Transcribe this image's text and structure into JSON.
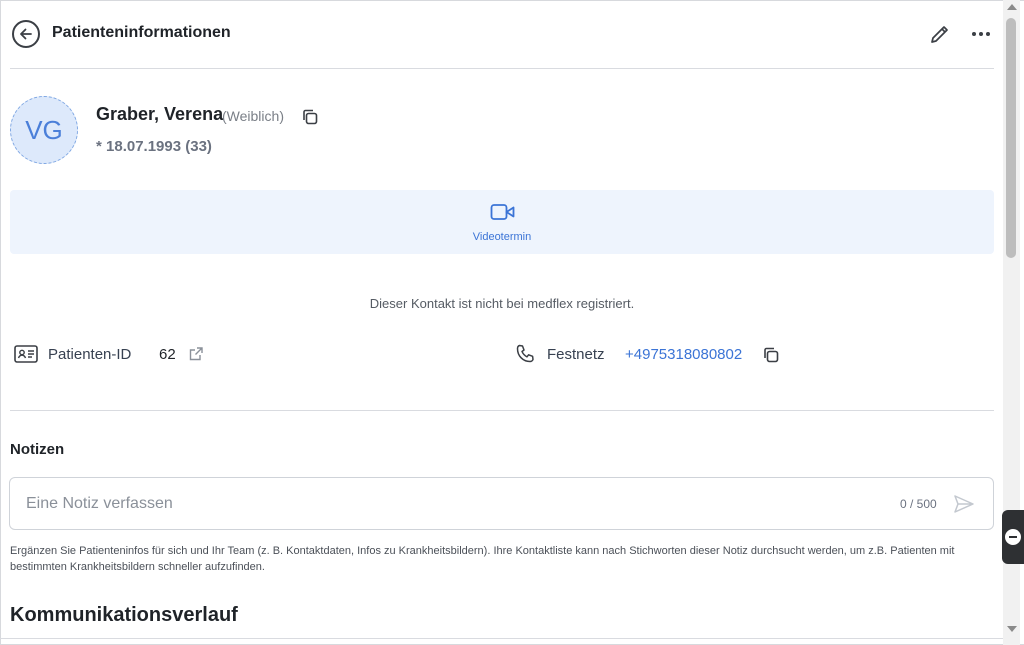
{
  "header": {
    "title": "Patienteninformationen",
    "back_icon": "arrow-left-circle-icon",
    "edit_icon": "pencil-icon",
    "more_icon": "ellipsis-icon"
  },
  "patient": {
    "initials": "VG",
    "name": "Graber, Verena",
    "gender": "(Weiblich)",
    "dob": "* 18.07.1993 (33)"
  },
  "video": {
    "label": "Videotermin",
    "icon": "video-camera-icon"
  },
  "status": {
    "not_registered": "Dieser Kontakt ist nicht bei medflex registriert."
  },
  "info": {
    "patient_id_label": "Patienten-ID",
    "patient_id_value": "62",
    "phone_label": "Festnetz",
    "phone_value": "+4975318080802"
  },
  "notes": {
    "heading": "Notizen",
    "placeholder": "Eine Notiz verfassen",
    "counter": "0 / 500",
    "help": "Ergänzen Sie Patienteninfos für sich und Ihr Team (z. B. Kontaktdaten, Infos zu Krankheitsbildern). Ihre Kontaktliste kann nach Stichworten dieser Notiz durchsucht werden, um z.B. Patienten mit bestimmten Krankheitsbildern schneller aufzufinden."
  },
  "communication": {
    "heading": "Kommunikationsverlauf"
  },
  "colors": {
    "accent": "#3b74d6",
    "avatar_bg": "#dde9fb",
    "tile_bg": "#eef4fd"
  }
}
